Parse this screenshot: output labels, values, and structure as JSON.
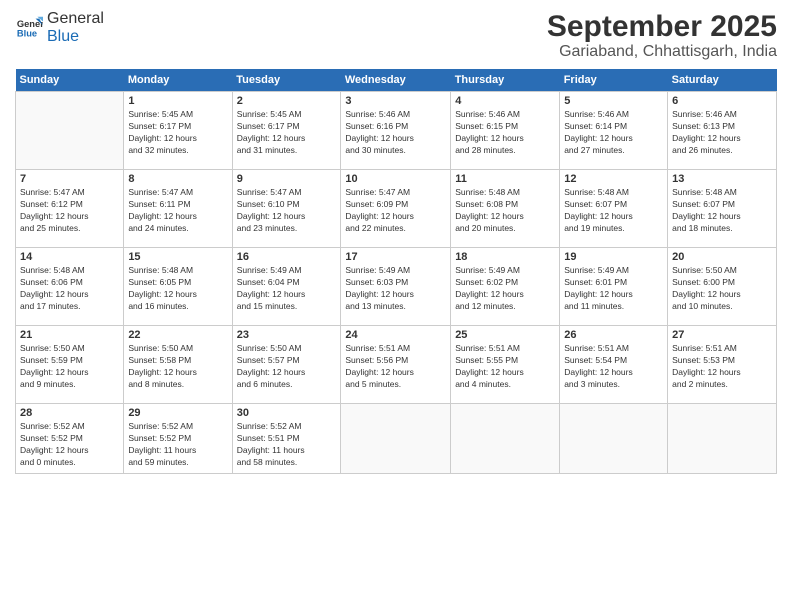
{
  "header": {
    "logo_general": "General",
    "logo_blue": "Blue",
    "month_title": "September 2025",
    "location": "Gariaband, Chhattisgarh, India"
  },
  "weekdays": [
    "Sunday",
    "Monday",
    "Tuesday",
    "Wednesday",
    "Thursday",
    "Friday",
    "Saturday"
  ],
  "weeks": [
    [
      {
        "day": "",
        "info": ""
      },
      {
        "day": "1",
        "info": "Sunrise: 5:45 AM\nSunset: 6:17 PM\nDaylight: 12 hours\nand 32 minutes."
      },
      {
        "day": "2",
        "info": "Sunrise: 5:45 AM\nSunset: 6:17 PM\nDaylight: 12 hours\nand 31 minutes."
      },
      {
        "day": "3",
        "info": "Sunrise: 5:46 AM\nSunset: 6:16 PM\nDaylight: 12 hours\nand 30 minutes."
      },
      {
        "day": "4",
        "info": "Sunrise: 5:46 AM\nSunset: 6:15 PM\nDaylight: 12 hours\nand 28 minutes."
      },
      {
        "day": "5",
        "info": "Sunrise: 5:46 AM\nSunset: 6:14 PM\nDaylight: 12 hours\nand 27 minutes."
      },
      {
        "day": "6",
        "info": "Sunrise: 5:46 AM\nSunset: 6:13 PM\nDaylight: 12 hours\nand 26 minutes."
      }
    ],
    [
      {
        "day": "7",
        "info": "Sunrise: 5:47 AM\nSunset: 6:12 PM\nDaylight: 12 hours\nand 25 minutes."
      },
      {
        "day": "8",
        "info": "Sunrise: 5:47 AM\nSunset: 6:11 PM\nDaylight: 12 hours\nand 24 minutes."
      },
      {
        "day": "9",
        "info": "Sunrise: 5:47 AM\nSunset: 6:10 PM\nDaylight: 12 hours\nand 23 minutes."
      },
      {
        "day": "10",
        "info": "Sunrise: 5:47 AM\nSunset: 6:09 PM\nDaylight: 12 hours\nand 22 minutes."
      },
      {
        "day": "11",
        "info": "Sunrise: 5:48 AM\nSunset: 6:08 PM\nDaylight: 12 hours\nand 20 minutes."
      },
      {
        "day": "12",
        "info": "Sunrise: 5:48 AM\nSunset: 6:07 PM\nDaylight: 12 hours\nand 19 minutes."
      },
      {
        "day": "13",
        "info": "Sunrise: 5:48 AM\nSunset: 6:07 PM\nDaylight: 12 hours\nand 18 minutes."
      }
    ],
    [
      {
        "day": "14",
        "info": "Sunrise: 5:48 AM\nSunset: 6:06 PM\nDaylight: 12 hours\nand 17 minutes."
      },
      {
        "day": "15",
        "info": "Sunrise: 5:48 AM\nSunset: 6:05 PM\nDaylight: 12 hours\nand 16 minutes."
      },
      {
        "day": "16",
        "info": "Sunrise: 5:49 AM\nSunset: 6:04 PM\nDaylight: 12 hours\nand 15 minutes."
      },
      {
        "day": "17",
        "info": "Sunrise: 5:49 AM\nSunset: 6:03 PM\nDaylight: 12 hours\nand 13 minutes."
      },
      {
        "day": "18",
        "info": "Sunrise: 5:49 AM\nSunset: 6:02 PM\nDaylight: 12 hours\nand 12 minutes."
      },
      {
        "day": "19",
        "info": "Sunrise: 5:49 AM\nSunset: 6:01 PM\nDaylight: 12 hours\nand 11 minutes."
      },
      {
        "day": "20",
        "info": "Sunrise: 5:50 AM\nSunset: 6:00 PM\nDaylight: 12 hours\nand 10 minutes."
      }
    ],
    [
      {
        "day": "21",
        "info": "Sunrise: 5:50 AM\nSunset: 5:59 PM\nDaylight: 12 hours\nand 9 minutes."
      },
      {
        "day": "22",
        "info": "Sunrise: 5:50 AM\nSunset: 5:58 PM\nDaylight: 12 hours\nand 8 minutes."
      },
      {
        "day": "23",
        "info": "Sunrise: 5:50 AM\nSunset: 5:57 PM\nDaylight: 12 hours\nand 6 minutes."
      },
      {
        "day": "24",
        "info": "Sunrise: 5:51 AM\nSunset: 5:56 PM\nDaylight: 12 hours\nand 5 minutes."
      },
      {
        "day": "25",
        "info": "Sunrise: 5:51 AM\nSunset: 5:55 PM\nDaylight: 12 hours\nand 4 minutes."
      },
      {
        "day": "26",
        "info": "Sunrise: 5:51 AM\nSunset: 5:54 PM\nDaylight: 12 hours\nand 3 minutes."
      },
      {
        "day": "27",
        "info": "Sunrise: 5:51 AM\nSunset: 5:53 PM\nDaylight: 12 hours\nand 2 minutes."
      }
    ],
    [
      {
        "day": "28",
        "info": "Sunrise: 5:52 AM\nSunset: 5:52 PM\nDaylight: 12 hours\nand 0 minutes."
      },
      {
        "day": "29",
        "info": "Sunrise: 5:52 AM\nSunset: 5:52 PM\nDaylight: 11 hours\nand 59 minutes."
      },
      {
        "day": "30",
        "info": "Sunrise: 5:52 AM\nSunset: 5:51 PM\nDaylight: 11 hours\nand 58 minutes."
      },
      {
        "day": "",
        "info": ""
      },
      {
        "day": "",
        "info": ""
      },
      {
        "day": "",
        "info": ""
      },
      {
        "day": "",
        "info": ""
      }
    ]
  ]
}
